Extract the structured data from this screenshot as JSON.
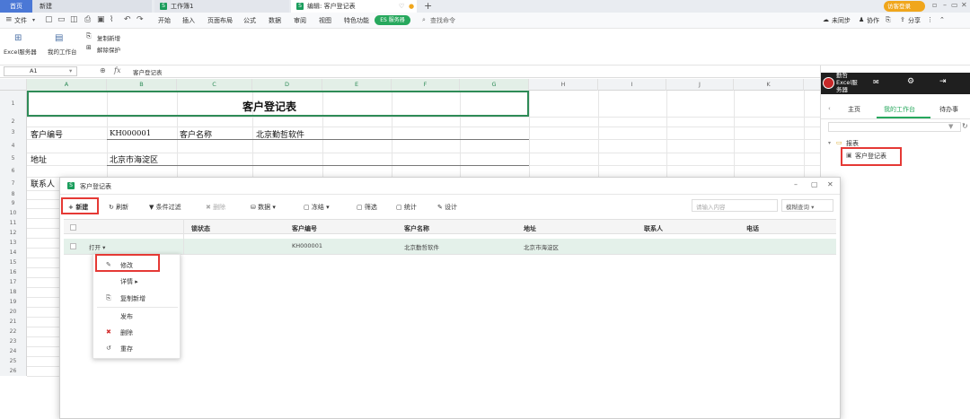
{
  "tabs": {
    "home": "首页",
    "new": "新建",
    "workbook": "工作簿1",
    "editing": "编辑: 客户登记表"
  },
  "header": {
    "guest_login": "访客登录",
    "sync": "未同步",
    "collab": "协作",
    "share": "分享"
  },
  "menu": {
    "file": "文件",
    "items": [
      "开始",
      "插入",
      "页面布局",
      "公式",
      "数据",
      "审阅",
      "视图",
      "特色功能"
    ],
    "es_button": "ES 服务器",
    "search": "查找命令"
  },
  "toolbar": {
    "excel_server": "Excel服务器",
    "my_workbench": "我的工作台",
    "copy_new": "复制新增",
    "unprotect": "解除保护"
  },
  "formula_bar": {
    "cell_ref": "A1",
    "fx": "fx",
    "content": "客户登记表"
  },
  "sheet": {
    "columns": [
      "A",
      "B",
      "C",
      "D",
      "E",
      "F",
      "G",
      "H",
      "I",
      "J",
      "K"
    ],
    "rows": [
      "1",
      "2",
      "3",
      "4",
      "5",
      "6",
      "7",
      "8",
      "9",
      "10",
      "11",
      "12",
      "13",
      "14",
      "15",
      "16",
      "17",
      "18",
      "19",
      "20",
      "21",
      "22",
      "23",
      "24",
      "25",
      "26"
    ],
    "title": "客户登记表",
    "label_customer_no": "客户编号",
    "value_customer_no": "KH000001",
    "label_customer_name": "客户名称",
    "value_customer_name": "北京勤哲软件",
    "label_address": "地址",
    "value_address": "北京市海淀区",
    "label_contact": "联系人"
  },
  "right_panel": {
    "brand_line1": "勤哲",
    "brand_line2": "Excel服",
    "brand_line3": "务器",
    "tab_home": "主页",
    "tab_workbench": "我的工作台",
    "tab_todo": "待办事",
    "folder": "报表",
    "report_item": "客户登记表"
  },
  "dialog": {
    "title": "客户登记表",
    "btn_new": "新建",
    "btn_refresh": "刷新",
    "btn_filter": "条件过滤",
    "btn_delete": "删除",
    "btn_data": "数据",
    "btn_freeze": "冻结",
    "btn_screen": "筛选",
    "btn_stats": "统计",
    "btn_design": "设计",
    "search_placeholder": "请输入内容",
    "fuzzy_query": "模糊查询",
    "columns": [
      "锁状态",
      "客户编号",
      "客户名称",
      "地址",
      "联系人",
      "电话"
    ],
    "row": {
      "action": "打开",
      "customer_no": "KH000001",
      "customer_name": "北京勤哲软件",
      "address": "北京市海淀区"
    }
  },
  "context_menu": {
    "edit": "修改",
    "detail": "详情",
    "copy_new": "复制新增",
    "publish": "发布",
    "delete": "删除",
    "resave": "重存"
  },
  "colors": {
    "accent_green": "#27a85d",
    "highlight_red": "#e53935",
    "home_tab_blue": "#4b78d6"
  }
}
